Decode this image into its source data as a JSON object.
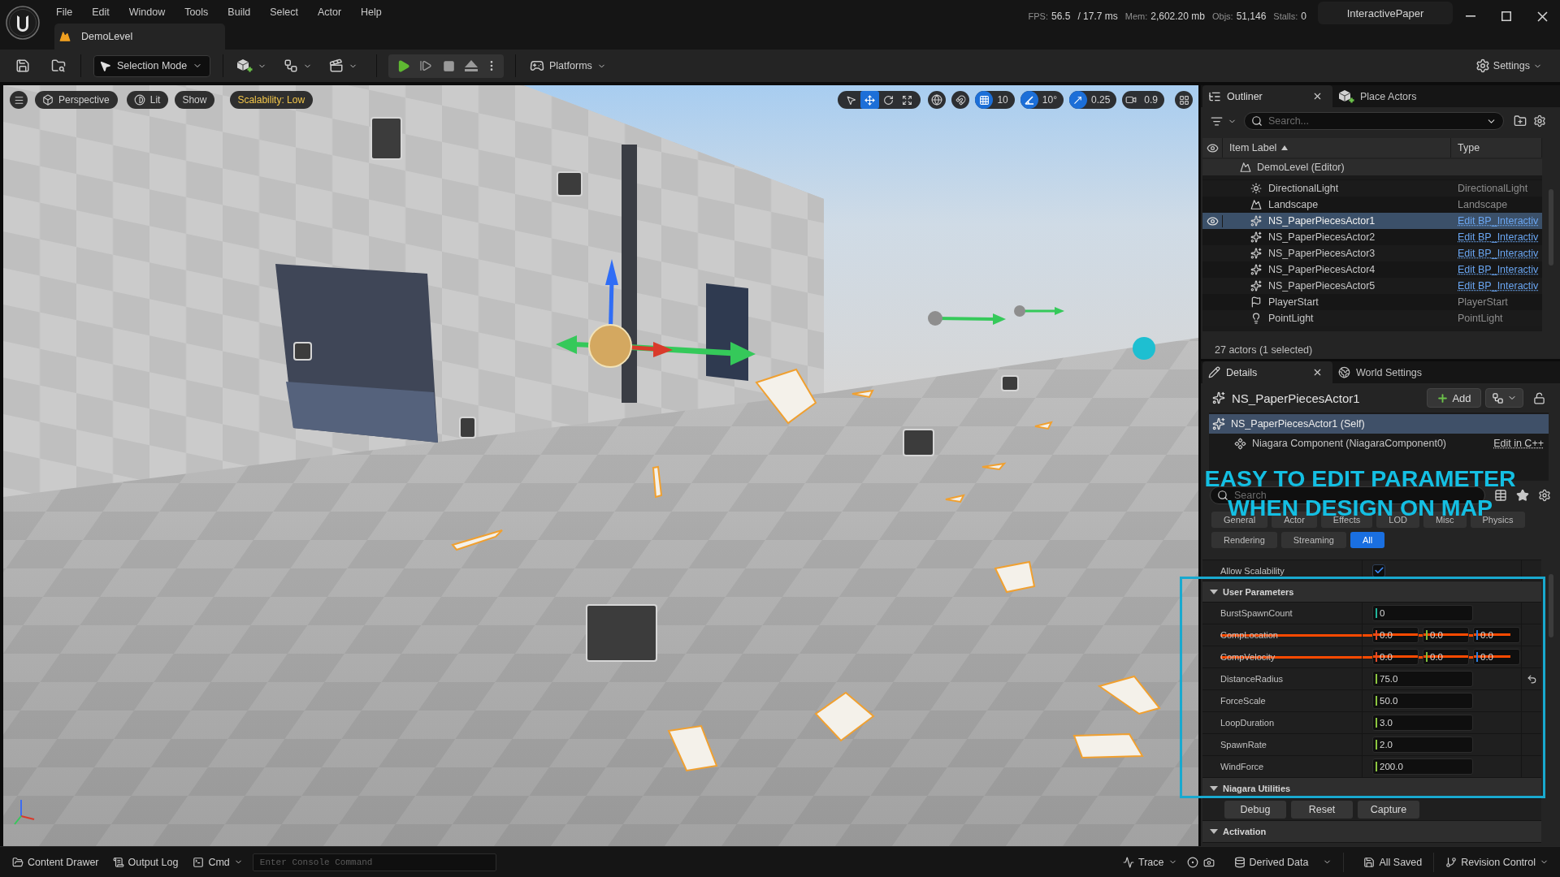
{
  "title_bar": {
    "menu": [
      "File",
      "Edit",
      "Window",
      "Tools",
      "Build",
      "Select",
      "Actor",
      "Help"
    ],
    "level_tab": "DemoLevel",
    "stats": [
      {
        "label": "FPS:",
        "value": "56.5"
      },
      {
        "value": "/ 17.7 ms"
      },
      {
        "label": "Mem:",
        "value": "2,602.20 mb"
      },
      {
        "label": "Objs:",
        "value": "51,146"
      },
      {
        "label": "Stalls:",
        "value": "0"
      }
    ],
    "project": "InteractivePaper"
  },
  "toolbar": {
    "mode_button": "Selection Mode",
    "platforms_button": "Platforms",
    "settings_button": "Settings"
  },
  "viewport": {
    "view_buttons": [
      {
        "kind": "perspective",
        "label": "Perspective"
      },
      {
        "kind": "lit",
        "label": "Lit"
      },
      {
        "kind": "show",
        "label": "Show"
      }
    ],
    "scalability": "Scalability: Low",
    "transform_tools": [
      {
        "kind": "select",
        "selected": false
      },
      {
        "kind": "translate",
        "selected": true
      },
      {
        "kind": "rotate",
        "selected": false
      },
      {
        "kind": "scale",
        "selected": false
      }
    ],
    "snaps": [
      {
        "kind": "grid",
        "on": true,
        "value": "10"
      },
      {
        "kind": "rotation",
        "on": true,
        "value": "10°"
      },
      {
        "kind": "scale",
        "on": true,
        "value": "0.25"
      }
    ],
    "camera_speed": "0.9"
  },
  "outliner": {
    "tabs": [
      {
        "label": "Outliner",
        "selected": true
      },
      {
        "label": "Place Actors",
        "selected": false
      }
    ],
    "search": {
      "placeholder": "Search..."
    },
    "columns": [
      "Item Label",
      "Type"
    ],
    "root": {
      "label": "DemoLevel (Editor)",
      "children": [
        {
          "label": "DirectionalLight",
          "type": "DirectionalLight",
          "kind": "directional-light",
          "selected": false,
          "link": false
        },
        {
          "label": "Landscape",
          "type": "Landscape",
          "kind": "landscape",
          "selected": false,
          "link": false
        },
        {
          "label": "NS_PaperPiecesActor1",
          "type": "Edit BP_Interactiv",
          "kind": "niagara",
          "selected": true,
          "link": true
        },
        {
          "label": "NS_PaperPiecesActor2",
          "type": "Edit BP_Interactiv",
          "kind": "niagara",
          "selected": false,
          "link": true
        },
        {
          "label": "NS_PaperPiecesActor3",
          "type": "Edit BP_Interactiv",
          "kind": "niagara",
          "selected": false,
          "link": true
        },
        {
          "label": "NS_PaperPiecesActor4",
          "type": "Edit BP_Interactiv",
          "kind": "niagara",
          "selected": false,
          "link": true
        },
        {
          "label": "NS_PaperPiecesActor5",
          "type": "Edit BP_Interactiv",
          "kind": "niagara",
          "selected": false,
          "link": true
        },
        {
          "label": "PlayerStart",
          "type": "PlayerStart",
          "kind": "player-start",
          "selected": false,
          "link": false
        },
        {
          "label": "PointLight",
          "type": "PointLight",
          "kind": "point-light",
          "selected": false,
          "link": false
        }
      ]
    },
    "status": "27 actors (1 selected)"
  },
  "details": {
    "tabs": [
      {
        "label": "Details",
        "selected": true
      },
      {
        "label": "World Settings",
        "selected": false
      }
    ],
    "actor": "NS_PaperPiecesActor1",
    "add_button": "Add",
    "components": [
      {
        "label": "NS_PaperPiecesActor1 (Self)",
        "selected": true,
        "children": [
          {
            "label": "Niagara Component (NiagaraComponent0)",
            "selected": false,
            "link": "Edit in C++"
          }
        ]
      }
    ],
    "search": {
      "placeholder": "Search"
    },
    "filters": [
      {
        "label": "General",
        "selected": false
      },
      {
        "label": "Actor",
        "selected": false
      },
      {
        "label": "Effects",
        "selected": false
      },
      {
        "label": "LOD",
        "selected": false
      },
      {
        "label": "Misc",
        "selected": false
      },
      {
        "label": "Physics",
        "selected": false
      },
      {
        "label": "Rendering",
        "selected": false
      },
      {
        "label": "Streaming",
        "selected": false
      },
      {
        "label": "All",
        "selected": true
      }
    ],
    "allow_scalability": {
      "label": "Allow Scalability",
      "checked": true
    },
    "sections": [
      {
        "title": "User Parameters",
        "expanded": true,
        "params": [
          {
            "name": "BurstSpawnCount",
            "kind": "int",
            "values": [
              "0"
            ],
            "struck": false,
            "reset": false
          },
          {
            "name": "CompLocation",
            "kind": "vector",
            "values": [
              "0.0",
              "0.0",
              "0.0"
            ],
            "struck": true,
            "reset": false
          },
          {
            "name": "CompVelocity",
            "kind": "vector",
            "values": [
              "0.0",
              "0.0",
              "0.0"
            ],
            "struck": true,
            "reset": false
          },
          {
            "name": "DistanceRadius",
            "kind": "float",
            "values": [
              "75.0"
            ],
            "struck": false,
            "reset": true
          },
          {
            "name": "ForceScale",
            "kind": "float",
            "values": [
              "50.0"
            ],
            "struck": false,
            "reset": false
          },
          {
            "name": "LoopDuration",
            "kind": "float",
            "values": [
              "3.0"
            ],
            "struck": false,
            "reset": false
          },
          {
            "name": "SpawnRate",
            "kind": "float",
            "values": [
              "2.0"
            ],
            "struck": false,
            "reset": false
          },
          {
            "name": "WindForce",
            "kind": "float",
            "values": [
              "200.0"
            ],
            "struck": false,
            "reset": false
          }
        ]
      },
      {
        "title": "Niagara Utilities",
        "expanded": true,
        "buttons": [
          "Debug",
          "Reset",
          "Capture"
        ]
      },
      {
        "title": "Activation",
        "expanded": true
      }
    ]
  },
  "annotation": {
    "caption": [
      "EASY TO EDIT PARAMETER",
      "WHEN DESIGN ON MAP"
    ]
  },
  "status_bar": {
    "content_drawer": "Content Drawer",
    "output_log": "Output Log",
    "cmd": "Cmd",
    "console": {
      "placeholder": "Enter Console Command"
    },
    "trace": "Trace",
    "derived_data": "Derived Data",
    "saved": "All Saved",
    "revision_control": "Revision Control"
  }
}
